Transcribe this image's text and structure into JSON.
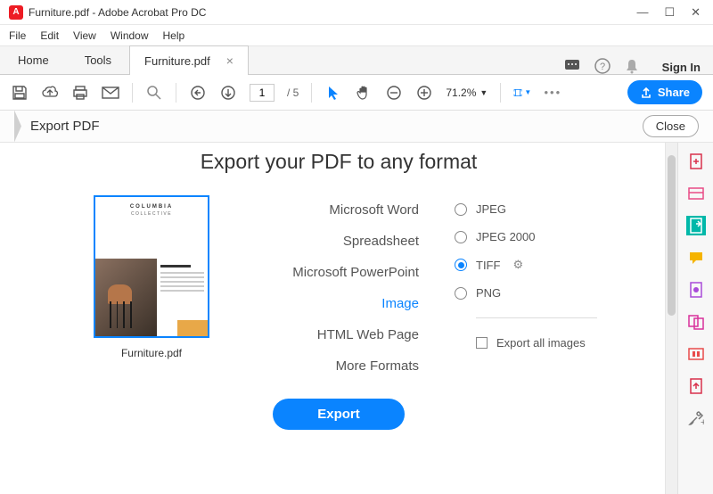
{
  "titlebar": {
    "title": "Furniture.pdf - Adobe Acrobat Pro DC",
    "app_icon": "A"
  },
  "menubar": [
    "File",
    "Edit",
    "View",
    "Window",
    "Help"
  ],
  "tabs": {
    "home": "Home",
    "tools": "Tools",
    "document": "Furniture.pdf",
    "sign_in": "Sign In"
  },
  "toolbar": {
    "page_current": "1",
    "page_total": "/ 5",
    "zoom": "71.2%",
    "share": "Share"
  },
  "panel": {
    "title": "Export PDF",
    "close": "Close"
  },
  "main": {
    "heading": "Export your PDF to any format",
    "thumbnail": {
      "brand1": "COLUMBIA",
      "brand2": "COLLECTIVE",
      "filename": "Furniture.pdf"
    },
    "formats": [
      "Microsoft Word",
      "Spreadsheet",
      "Microsoft PowerPoint",
      "Image",
      "HTML Web Page",
      "More Formats"
    ],
    "active_format_index": 3,
    "image_options": [
      "JPEG",
      "JPEG 2000",
      "TIFF",
      "PNG"
    ],
    "selected_option_index": 2,
    "export_all": "Export all images",
    "export_btn": "Export"
  }
}
